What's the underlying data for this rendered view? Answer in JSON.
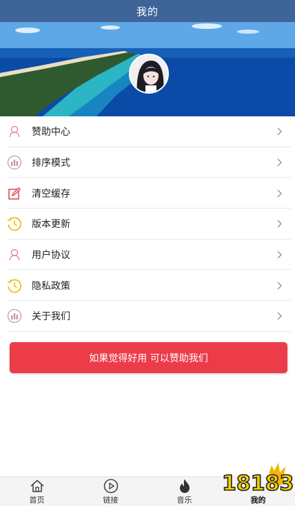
{
  "header": {
    "title": "我的"
  },
  "profile": {
    "avatar_icon": "user-avatar"
  },
  "menu": {
    "items": [
      {
        "label": "赞助中心",
        "icon": "user-icon",
        "color": "#e9858f"
      },
      {
        "label": "排序模式",
        "icon": "bar-chart-icon",
        "color": "#c79aa3"
      },
      {
        "label": "清空缓存",
        "icon": "edit-icon",
        "color": "#d9434f"
      },
      {
        "label": "版本更新",
        "icon": "clock-icon",
        "color": "#e6c320"
      },
      {
        "label": "用户协议",
        "icon": "user-icon",
        "color": "#e9858f"
      },
      {
        "label": "隐私政策",
        "icon": "clock-icon",
        "color": "#e6c320"
      },
      {
        "label": "关于我们",
        "icon": "bar-chart-icon",
        "color": "#c79aa3"
      }
    ]
  },
  "sponsor_button": {
    "label": "如果觉得好用 可以赞助我们",
    "color": "#ec3c4a"
  },
  "tabbar": {
    "tabs": [
      {
        "label": "首页",
        "icon": "home-icon"
      },
      {
        "label": "链接",
        "icon": "play-icon"
      },
      {
        "label": "音乐",
        "icon": "fire-icon"
      },
      {
        "label": "我的",
        "icon": "profile-icon",
        "active": true
      }
    ]
  },
  "watermark": {
    "text": "18183"
  },
  "colors": {
    "title_bar": "#3f6497",
    "accent": "#ec3c4a"
  }
}
